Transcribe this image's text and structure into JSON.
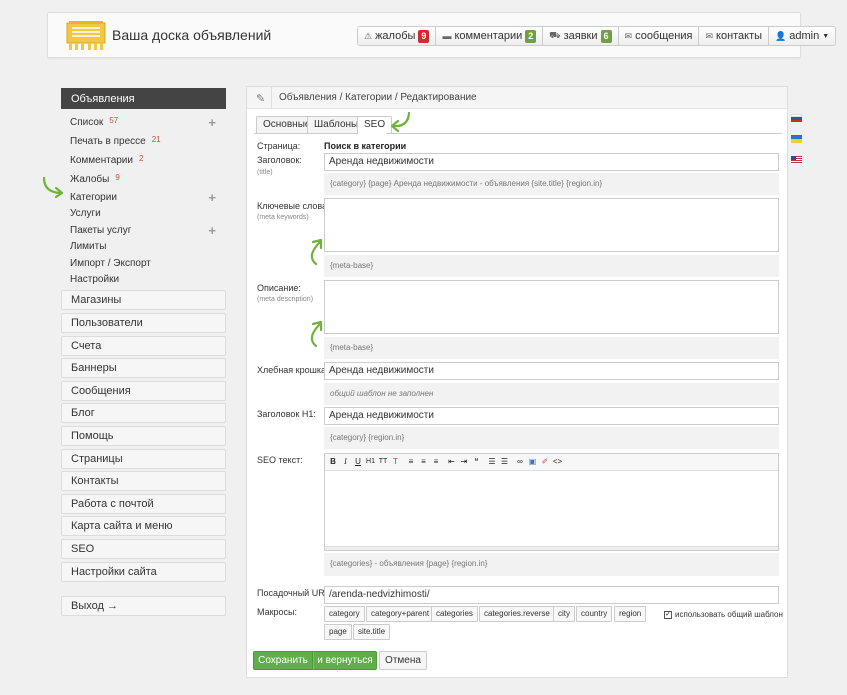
{
  "header": {
    "site_title": "Ваша доска объявлений",
    "nav": [
      {
        "icon": "warning-icon",
        "label": "жалобы",
        "badge": "9",
        "badge_color": "#c7302a"
      },
      {
        "icon": "comment-icon",
        "label": "комментарии",
        "badge": "2",
        "badge_color": "#6fa042"
      },
      {
        "icon": "cart-icon",
        "label": "заявки",
        "badge": "6",
        "badge_color": "#6fa042"
      },
      {
        "icon": "envelope-icon",
        "label": "сообщения"
      },
      {
        "icon": "envelope-icon",
        "label": "контакты"
      },
      {
        "icon": "user-icon",
        "label": "admin"
      }
    ]
  },
  "sidebar": {
    "title": "Объявления",
    "sub_items": [
      {
        "label": "Список",
        "count": "57"
      },
      {
        "label": "Печать в прессе",
        "count": "21"
      },
      {
        "label": "Комментарии",
        "count": "2"
      },
      {
        "label": "Жалобы",
        "count": "9"
      },
      {
        "label": "Категории"
      },
      {
        "label": "Услуги"
      },
      {
        "label": "Пакеты услуг"
      },
      {
        "label": "Лимиты"
      },
      {
        "label": "Импорт / Экспорт"
      },
      {
        "label": "Настройки"
      }
    ],
    "menu": [
      "Магазины",
      "Пользователи",
      "Счета",
      "Баннеры",
      "Сообщения",
      "Блог",
      "Помощь",
      "Страницы",
      "Контакты",
      "Работа с почтой",
      "Карта сайта и меню",
      "SEO",
      "Настройки сайта"
    ],
    "logout": "Выход →"
  },
  "panel": {
    "breadcrumb": "Объявления / Категории / Редактирование",
    "tabs": [
      "Основные",
      "Шаблоны",
      "SEO"
    ],
    "active_tab": "SEO"
  },
  "form": {
    "page_label": "Страница:",
    "page_value": "Поиск в категории",
    "title_label": "Заголовок:",
    "title_hint": "(title)",
    "title_value": "Аренда недвижимости",
    "title_template": "{category} {page} Аренда недвижимости - объявления {site.title} {region.in}",
    "keywords_label": "Ключевые слова:",
    "keywords_hint": "(meta keywords)",
    "keywords_template": "{meta-base}",
    "description_label": "Описание:",
    "description_hint": "(meta description)",
    "description_template": "{meta-base}",
    "breadcrumb_label": "Хлебная крошка:",
    "breadcrumb_value": "Аренда недвижимости",
    "breadcrumb_template": "общий шаблон не заполнен",
    "h1_label": "Заголовок H1:",
    "h1_value": "Аренда недвижимости",
    "h1_template": "{category} {region.in}",
    "seo_text_label": "SEO текст:",
    "seo_text_template": "{categories} - объявления {page} {region.in}",
    "url_label": "Посадочный URL:",
    "url_value": "/arenda-nedvizhimosti/",
    "macros_label": "Макросы:",
    "macros": [
      "category",
      "category+parent",
      "categories",
      "categories.reverse",
      "city",
      "country",
      "region",
      "page",
      "site.title"
    ],
    "use_common_label": "использовать общий шаблон",
    "use_common_checked": true
  },
  "buttons": {
    "save": "Сохранить",
    "save_back": "и вернуться",
    "cancel": "Отмена"
  }
}
